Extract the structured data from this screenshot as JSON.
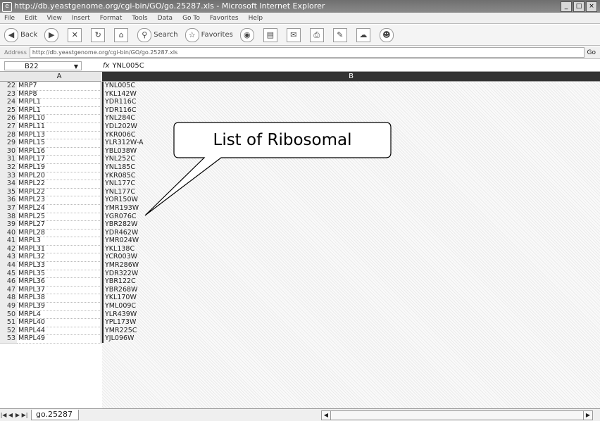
{
  "window": {
    "title": "http://db.yeastgenome.org/cgi-bin/GO/go.25287.xls - Microsoft Internet Explorer",
    "buttons": [
      "_",
      "□",
      "×"
    ]
  },
  "menu": [
    "File",
    "Edit",
    "View",
    "Insert",
    "Format",
    "Tools",
    "Data",
    "Go To",
    "Favorites",
    "Help"
  ],
  "toolbar": {
    "back": "Back",
    "search": "Search",
    "favorites": "Favorites"
  },
  "address": {
    "label": "Address",
    "url": "http://db.yeastgenome.org/cgi-bin/GO/go.25287.xls",
    "go": "Go"
  },
  "formula": {
    "cell": "B22",
    "fx": "fx",
    "value": "YNL005C"
  },
  "columns": {
    "a": "A",
    "b": "B"
  },
  "rows": [
    {
      "n": "22",
      "a": "MRP7",
      "b": "YNL005C"
    },
    {
      "n": "23",
      "a": "MRP8",
      "b": "YKL142W"
    },
    {
      "n": "24",
      "a": "MRPL1",
      "b": "YDR116C"
    },
    {
      "n": "25",
      "a": "MRPL1",
      "b": "YDR116C"
    },
    {
      "n": "26",
      "a": "MRPL10",
      "b": "YNL284C"
    },
    {
      "n": "27",
      "a": "MRPL11",
      "b": "YDL202W"
    },
    {
      "n": "28",
      "a": "MRPL13",
      "b": "YKR006C"
    },
    {
      "n": "29",
      "a": "MRPL15",
      "b": "YLR312W-A"
    },
    {
      "n": "30",
      "a": "MRPL16",
      "b": "YBL038W"
    },
    {
      "n": "31",
      "a": "MRPL17",
      "b": "YNL252C"
    },
    {
      "n": "32",
      "a": "MRPL19",
      "b": "YNL185C"
    },
    {
      "n": "33",
      "a": "MRPL20",
      "b": "YKR085C"
    },
    {
      "n": "34",
      "a": "MRPL22",
      "b": "YNL177C"
    },
    {
      "n": "35",
      "a": "MRPL22",
      "b": "YNL177C"
    },
    {
      "n": "36",
      "a": "MRPL23",
      "b": "YOR150W"
    },
    {
      "n": "37",
      "a": "MRPL24",
      "b": "YMR193W"
    },
    {
      "n": "38",
      "a": "MRPL25",
      "b": "YGR076C"
    },
    {
      "n": "39",
      "a": "MRPL27",
      "b": "YBR282W"
    },
    {
      "n": "40",
      "a": "MRPL28",
      "b": "YDR462W"
    },
    {
      "n": "41",
      "a": "MRPL3",
      "b": "YMR024W"
    },
    {
      "n": "42",
      "a": "MRPL31",
      "b": "YKL138C"
    },
    {
      "n": "43",
      "a": "MRPL32",
      "b": "YCR003W"
    },
    {
      "n": "44",
      "a": "MRPL33",
      "b": "YMR286W"
    },
    {
      "n": "45",
      "a": "MRPL35",
      "b": "YDR322W"
    },
    {
      "n": "46",
      "a": "MRPL36",
      "b": "YBR122C"
    },
    {
      "n": "47",
      "a": "MRPL37",
      "b": "YBR268W"
    },
    {
      "n": "48",
      "a": "MRPL38",
      "b": "YKL170W"
    },
    {
      "n": "49",
      "a": "MRPL39",
      "b": "YML009C"
    },
    {
      "n": "50",
      "a": "MRPL4",
      "b": "YLR439W"
    },
    {
      "n": "51",
      "a": "MRPL40",
      "b": "YPL173W"
    },
    {
      "n": "52",
      "a": "MRPL44",
      "b": "YMR225C"
    },
    {
      "n": "53",
      "a": "MRPL49",
      "b": "YJL096W"
    }
  ],
  "callout": {
    "text": "List of Ribosomal"
  },
  "sheet": {
    "tab": "go.25287"
  }
}
